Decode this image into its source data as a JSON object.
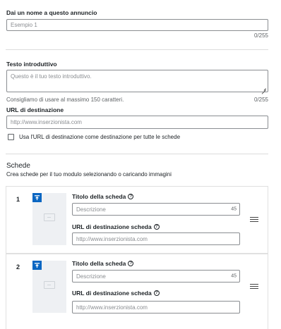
{
  "name_section": {
    "label": "Dai un nome a questo annuncio",
    "placeholder": "Esempio 1",
    "counter": "0/255"
  },
  "intro_section": {
    "label": "Testo introduttivo",
    "placeholder": "Questo è il tuo testo introduttivo.",
    "hint": "Consigliamo di usare al massimo 150 caratteri.",
    "counter": "0/255"
  },
  "url_section": {
    "label": "URL di destinazione",
    "placeholder": "http://www.inserzionista.com",
    "checkbox_label": "Usa l'URL di destinazione come destinazione per tutte le schede",
    "checkbox_checked": false
  },
  "cards_section": {
    "title": "Schede",
    "subtitle": "Crea schede per il tuo modulo selezionando o caricando immagini",
    "cards": [
      {
        "number": "1",
        "title_label": "Titolo della scheda",
        "title_placeholder": "Descrizione",
        "title_count": "45",
        "url_label": "URL di destinazione scheda",
        "url_placeholder": "http://www.inserzionista.com"
      },
      {
        "number": "2",
        "title_label": "Titolo della scheda",
        "title_placeholder": "Descrizione",
        "title_count": "45",
        "url_label": "URL di destinazione scheda",
        "url_placeholder": "http://www.inserzionista.com"
      }
    ]
  },
  "icons": {
    "help": "question-circle-icon",
    "upload": "upload-icon",
    "drag": "drag-handle-icon",
    "image": "image-placeholder-icon"
  },
  "colors": {
    "accent": "#0a66c2",
    "border": "#8a8d91",
    "divider": "#dcdcdc",
    "image_bg": "#eef0f3"
  }
}
